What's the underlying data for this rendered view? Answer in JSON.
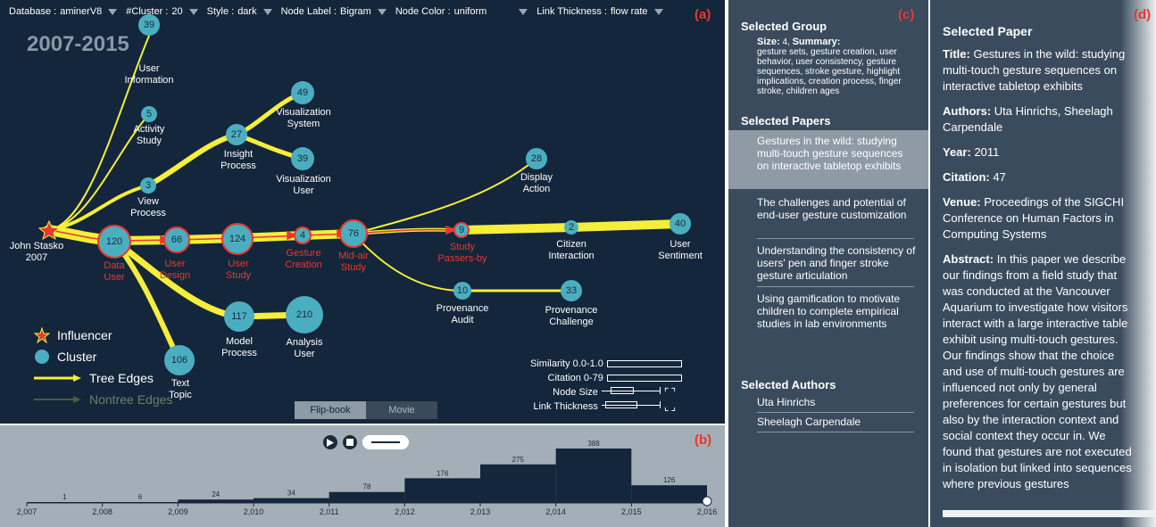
{
  "toolbar": {
    "database_label": "Database :",
    "database_value": "aminerV8",
    "cluster_label": "#Cluster :",
    "cluster_value": "20",
    "style_label": "Style :",
    "style_value": "dark",
    "node_label_label": "Node Label :",
    "node_label_value": "Bigram",
    "node_color_label": "Node Color :",
    "node_color_value": "uniform",
    "link_thickness_label": "Link Thickness :",
    "link_thickness_value": "flow rate"
  },
  "panel_tags": {
    "a": "(a)",
    "b": "(b)",
    "c": "(c)",
    "d": "(d)"
  },
  "year_range": "2007-2015",
  "colors": {
    "background": "#14263b",
    "tree_edge": "#f5ee3a",
    "highlight_edge": "#e8382f",
    "cluster": "#4aaec0",
    "influencer": "#e8382f"
  },
  "influencer": {
    "name": "John Stasko",
    "year": "2007"
  },
  "nodes": [
    {
      "id": "n39a",
      "num": "39",
      "label": [
        "User",
        "Information"
      ],
      "red": false
    },
    {
      "id": "n5",
      "num": "5",
      "label": [
        "Activity",
        "Study"
      ],
      "red": false
    },
    {
      "id": "n3",
      "num": "3",
      "label": [
        "View",
        "Process"
      ],
      "red": false
    },
    {
      "id": "n27",
      "num": "27",
      "label": [
        "Insight",
        "Process"
      ],
      "red": false
    },
    {
      "id": "n49",
      "num": "49",
      "label": [
        "Visualization",
        "System"
      ],
      "red": false
    },
    {
      "id": "n39b",
      "num": "39",
      "label": [
        "Visualization",
        "User"
      ],
      "red": false
    },
    {
      "id": "n28",
      "num": "28",
      "label": [
        "Display",
        "Action"
      ],
      "red": false
    },
    {
      "id": "n120",
      "num": "120",
      "label": [
        "Data",
        "User"
      ],
      "red": true
    },
    {
      "id": "n66",
      "num": "66",
      "label": [
        "User",
        "Design"
      ],
      "red": true
    },
    {
      "id": "n124",
      "num": "124",
      "label": [
        "User",
        "Study"
      ],
      "red": true
    },
    {
      "id": "n4",
      "num": "4",
      "label": [
        "Gesture",
        "Creation"
      ],
      "red": true
    },
    {
      "id": "n76",
      "num": "76",
      "label": [
        "Mid-air",
        "Study"
      ],
      "red": true
    },
    {
      "id": "n9",
      "num": "9",
      "label": [
        "Study",
        "Passers-by"
      ],
      "red": true
    },
    {
      "id": "n2",
      "num": "2",
      "label": [
        "Citizen",
        "Interaction"
      ],
      "red": false
    },
    {
      "id": "n40",
      "num": "40",
      "label": [
        "User",
        "Sentiment"
      ],
      "red": false
    },
    {
      "id": "n10",
      "num": "10",
      "label": [
        "Provenance",
        "Audit"
      ],
      "red": false
    },
    {
      "id": "n33",
      "num": "33",
      "label": [
        "Provenance",
        "Challenge"
      ],
      "red": false
    },
    {
      "id": "n117",
      "num": "117",
      "label": [
        "Model",
        "Process"
      ],
      "red": false
    },
    {
      "id": "n210",
      "num": "210",
      "label": [
        "Analysis",
        "User"
      ],
      "red": false
    },
    {
      "id": "n106",
      "num": "106",
      "label": [
        "Text",
        "Topic"
      ],
      "red": false
    }
  ],
  "legend": {
    "influencer": "Influencer",
    "cluster": "Cluster",
    "tree_edges": "Tree Edges",
    "nontree_edges": "Nontree Edges"
  },
  "sliders": {
    "similarity": "Similarity 0.0-1.0",
    "citation": "Citation 0-79",
    "node_size": "Node Size",
    "link_thickness": "Link Thickness"
  },
  "mode_tabs": {
    "flipbook": "Flip-book",
    "movie": "Movie"
  },
  "chart_data": {
    "type": "bar",
    "x": [
      "2,007",
      "2,008",
      "2,009",
      "2,010",
      "2,011",
      "2,012",
      "2,013",
      "2,014",
      "2,015",
      "2,016"
    ],
    "categories": [
      "2007",
      "2008",
      "2009",
      "2010",
      "2011",
      "2012",
      "2013",
      "2014",
      "2015"
    ],
    "values": [
      1,
      6,
      24,
      34,
      78,
      176,
      275,
      388,
      126
    ],
    "ylim": [
      0,
      388
    ]
  },
  "selected_group": {
    "heading": "Selected Group",
    "size_label": "Size:",
    "size_value": "4,",
    "summary_label": "Summary:",
    "summary": "gesture sets, gesture creation, user behavior, user consistency, gesture sequences, stroke gesture, highlight implications, creation process, finger stroke, children ages"
  },
  "selected_papers": {
    "heading": "Selected Papers",
    "items": [
      "Gestures in the wild: studying multi-touch gesture sequences on interactive tabletop exhibits",
      "The challenges and potential of end-user gesture customization",
      "Understanding the consistency of users' pen and finger stroke gesture articulation",
      "Using gamification to motivate children to complete empirical studies in lab environments"
    ]
  },
  "selected_authors": {
    "heading": "Selected Authors",
    "items": [
      "Uta Hinrichs",
      "Sheelagh Carpendale"
    ]
  },
  "selected_paper": {
    "heading": "Selected Paper",
    "title_label": "Title:",
    "title": "Gestures in the wild: studying multi-touch gesture sequences on interactive tabletop exhibits",
    "authors_label": "Authors:",
    "authors": "Uta Hinrichs, Sheelagh Carpendale",
    "year_label": "Year:",
    "year": "2011",
    "citation_label": "Citation:",
    "citation": "47",
    "venue_label": "Venue:",
    "venue": "Proceedings of the SIGCHI Conference on Human Factors in Computing Systems",
    "abstract_label": "Abstract:",
    "abstract": "In this paper we describe our findings from a field study that was conducted at the Vancouver Aquarium to investigate how visitors interact with a large interactive table exhibit using multi-touch gestures. Our findings show that the choice and use of multi-touch gestures are influenced not only by general preferences for certain gestures but also by the interaction context and social context they occur in. We found that gestures are not executed in isolation but linked into sequences where previous gestures"
  }
}
